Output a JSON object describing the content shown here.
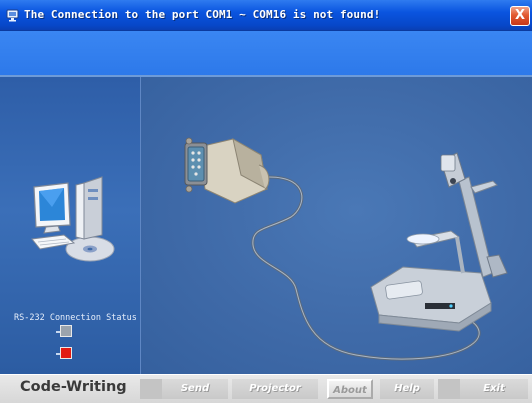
{
  "window": {
    "title": "The Connection to the port COM1 ~ COM16 is not found!",
    "close_symbol": "X"
  },
  "left_panel": {
    "computer_icon": "desktop-computer-icon",
    "status_label": "RS-232 Connection Status",
    "leds": [
      {
        "name": "grey",
        "color": "#9aa3ad"
      },
      {
        "name": "red",
        "color": "#e21b12"
      }
    ]
  },
  "main": {
    "connector_icon": "serial-connector-icon",
    "device_icon": "document-camera-icon"
  },
  "toolbar": {
    "brand": "Code-Writing",
    "send_label": "Send",
    "projector_label": "Projector",
    "about_label": "About",
    "help_label": "Help",
    "exit_label": "Exit"
  },
  "colors": {
    "titlebar": "#0a55e0",
    "header": "#3a86f2",
    "panel": "#3f6aa8",
    "toolbar": "#d6d6d6",
    "led_red": "#e21b12"
  }
}
